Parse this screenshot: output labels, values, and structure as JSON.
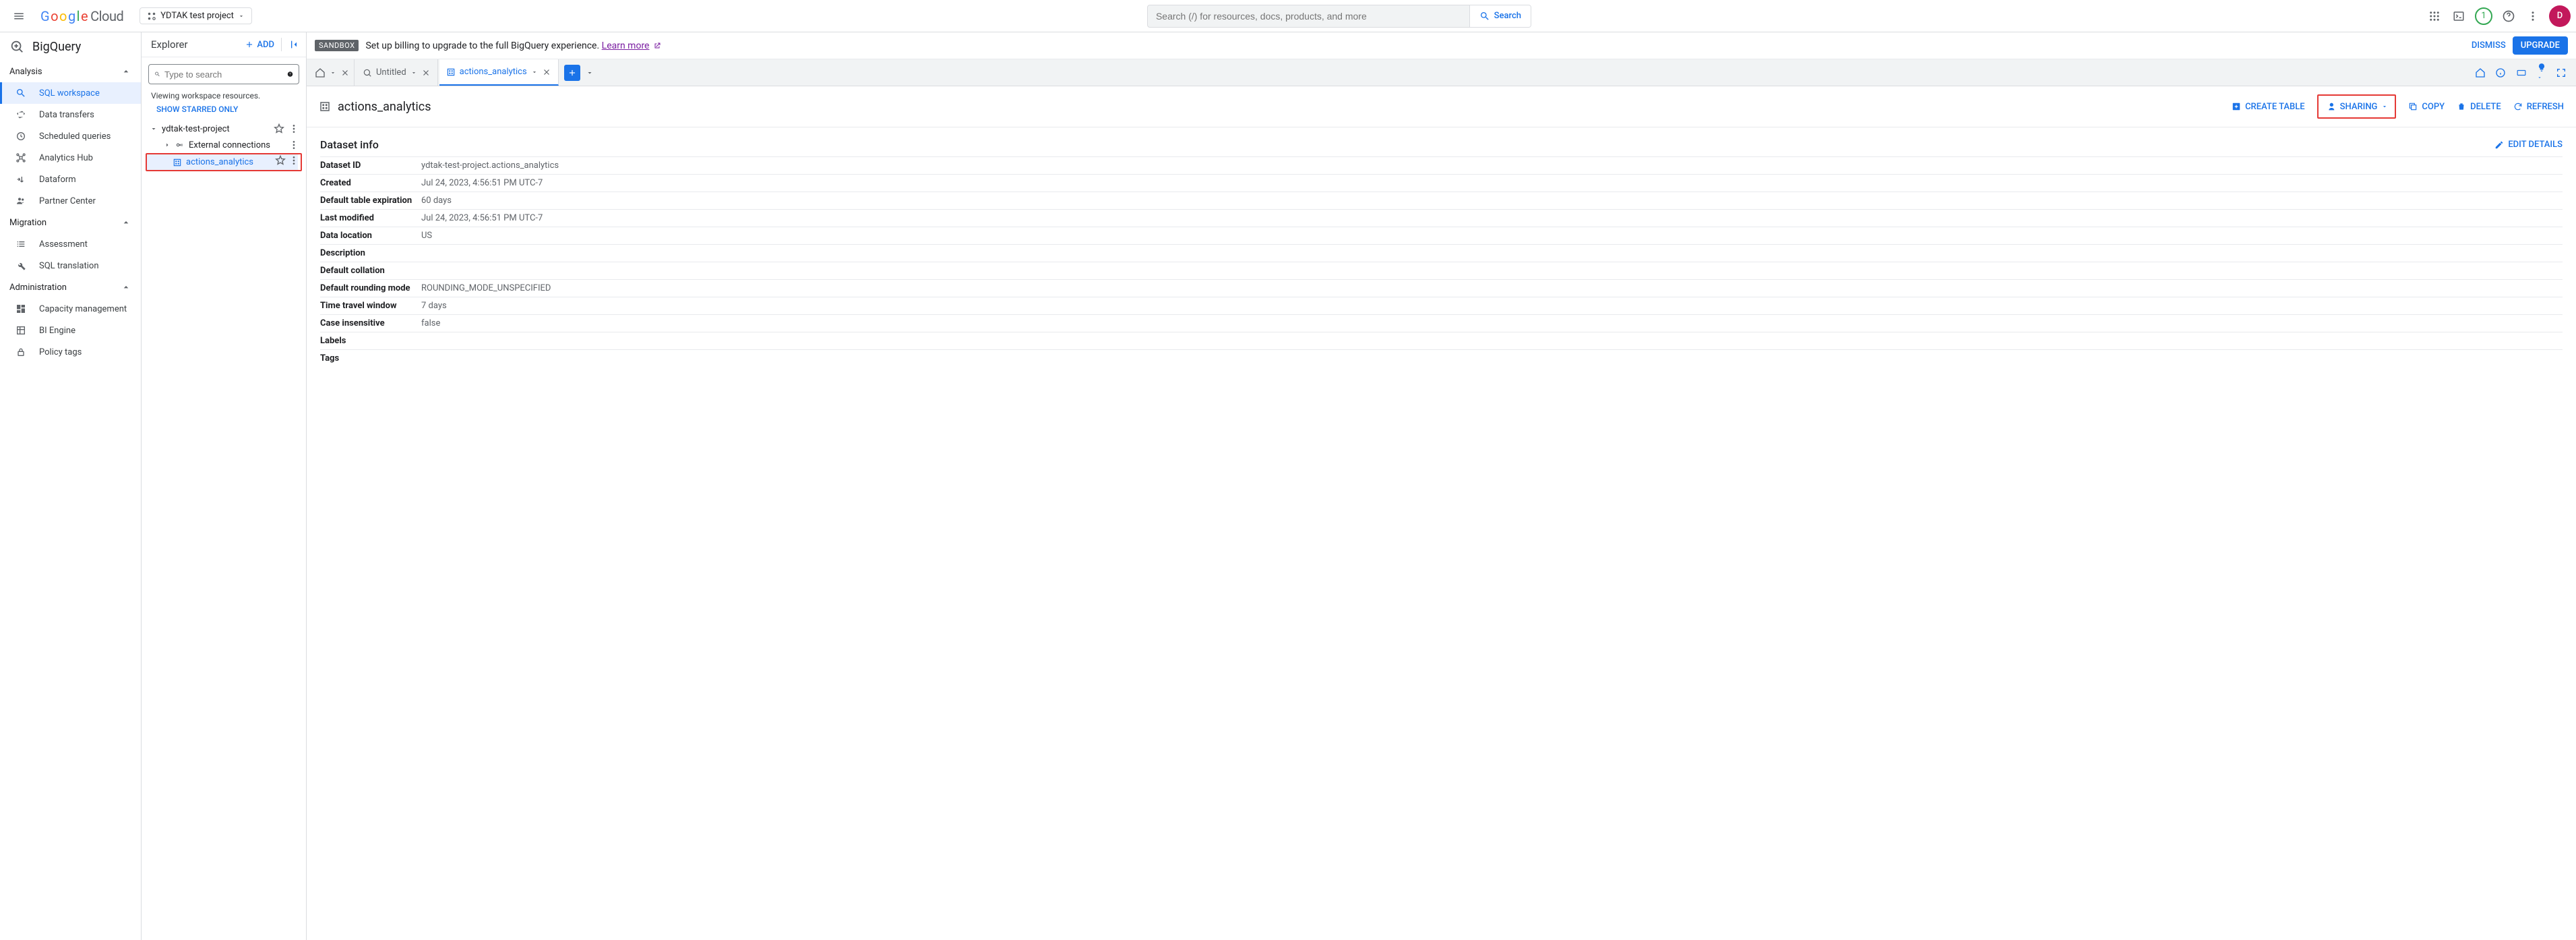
{
  "header": {
    "logo_cloud": "Cloud",
    "project_name": "YDTAK test project",
    "search_placeholder": "Search (/) for resources, docs, products, and more",
    "search_button": "Search",
    "badge_count": "1",
    "avatar_letter": "D"
  },
  "leftnav": {
    "product": "BigQuery",
    "sections": {
      "analysis": "Analysis",
      "migration": "Migration",
      "administration": "Administration"
    },
    "items": {
      "sql_workspace": "SQL workspace",
      "data_transfers": "Data transfers",
      "scheduled_queries": "Scheduled queries",
      "analytics_hub": "Analytics Hub",
      "dataform": "Dataform",
      "partner_center": "Partner Center",
      "assessment": "Assessment",
      "sql_translation": "SQL translation",
      "capacity_mgmt": "Capacity management",
      "bi_engine": "BI Engine",
      "policy_tags": "Policy tags"
    }
  },
  "explorer": {
    "title": "Explorer",
    "add": "ADD",
    "search_placeholder": "Type to search",
    "viewing_note": "Viewing workspace resources.",
    "starred_link": "SHOW STARRED ONLY",
    "project": "ydtak-test-project",
    "ext_conn": "External connections",
    "dataset": "actions_analytics"
  },
  "banner": {
    "chip": "SANDBOX",
    "text": "Set up billing to upgrade to the full BigQuery experience. ",
    "link": "Learn more",
    "dismiss": "DISMISS",
    "upgrade": "UPGRADE"
  },
  "tabs": {
    "untitled": "Untitled",
    "dataset": "actions_analytics"
  },
  "page": {
    "title": "actions_analytics",
    "actions": {
      "create_table": "CREATE TABLE",
      "sharing": "SHARING",
      "copy": "COPY",
      "delete": "DELETE",
      "refresh": "REFRESH"
    },
    "info_title": "Dataset info",
    "edit_details": "EDIT DETAILS",
    "rows": [
      {
        "k": "Dataset ID",
        "v": "ydtak-test-project.actions_analytics"
      },
      {
        "k": "Created",
        "v": "Jul 24, 2023, 4:56:51 PM UTC-7"
      },
      {
        "k": "Default table expiration",
        "v": "60 days"
      },
      {
        "k": "Last modified",
        "v": "Jul 24, 2023, 4:56:51 PM UTC-7"
      },
      {
        "k": "Data location",
        "v": "US"
      },
      {
        "k": "Description",
        "v": ""
      },
      {
        "k": "Default collation",
        "v": ""
      },
      {
        "k": "Default rounding mode",
        "v": "ROUNDING_MODE_UNSPECIFIED"
      },
      {
        "k": "Time travel window",
        "v": "7 days"
      },
      {
        "k": "Case insensitive",
        "v": "false"
      },
      {
        "k": "Labels",
        "v": ""
      },
      {
        "k": "Tags",
        "v": ""
      }
    ]
  }
}
